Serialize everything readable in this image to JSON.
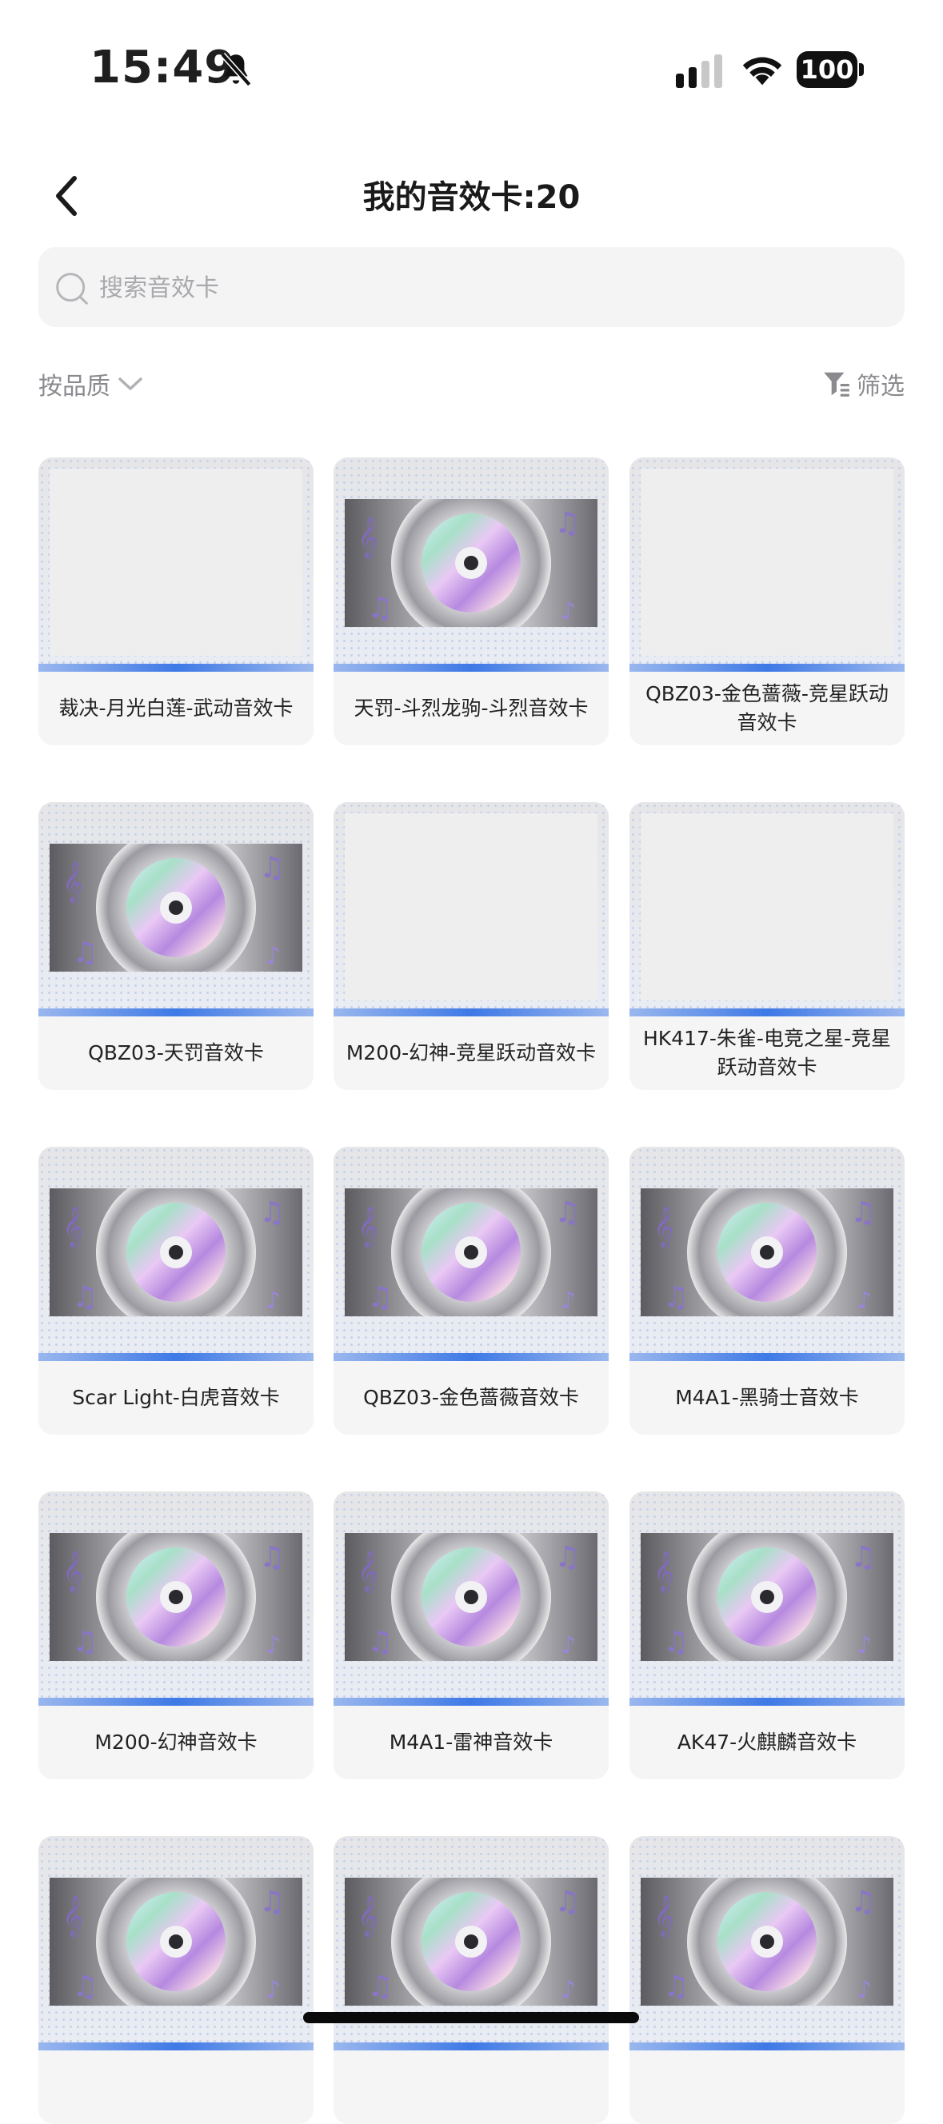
{
  "status_bar": {
    "time": "15:49",
    "battery": "100",
    "icons": [
      "bell-slash-icon",
      "signal-icon",
      "wifi-icon",
      "battery-icon"
    ]
  },
  "header": {
    "title": "我的音效卡:20",
    "back_icon": "chevron-left-icon"
  },
  "search": {
    "placeholder": "搜索音效卡",
    "value": ""
  },
  "sort": {
    "label": "按品质",
    "icon": "chevron-down-icon"
  },
  "filter": {
    "label": "筛选",
    "icon": "filter-icon"
  },
  "colors": {
    "accent_bar": "#3e79e6",
    "card_bg": "#f5f5f6",
    "search_bg": "#f4f4f5",
    "muted_text": "#8a8a8f"
  },
  "cards": [
    {
      "label": "裁决-月光白莲-武动音效卡",
      "has_art": false
    },
    {
      "label": "天罚-斗烈龙驹-斗烈音效卡",
      "has_art": true
    },
    {
      "label": "QBZ03-金色蔷薇-竞星跃动音效卡",
      "has_art": false
    },
    {
      "label": "QBZ03-天罚音效卡",
      "has_art": true
    },
    {
      "label": "M200-幻神-竞星跃动音效卡",
      "has_art": false
    },
    {
      "label": "HK417-朱雀-电竞之星-竞星跃动音效卡",
      "has_art": false
    },
    {
      "label": "Scar Light-白虎音效卡",
      "has_art": true
    },
    {
      "label": "QBZ03-金色蔷薇音效卡",
      "has_art": true
    },
    {
      "label": "M4A1-黑骑士音效卡",
      "has_art": true
    },
    {
      "label": "M200-幻神音效卡",
      "has_art": true
    },
    {
      "label": "M4A1-雷神音效卡",
      "has_art": true
    },
    {
      "label": "AK47-火麒麟音效卡",
      "has_art": true
    },
    {
      "label": "",
      "has_art": true
    },
    {
      "label": "",
      "has_art": true
    },
    {
      "label": "",
      "has_art": true
    }
  ]
}
